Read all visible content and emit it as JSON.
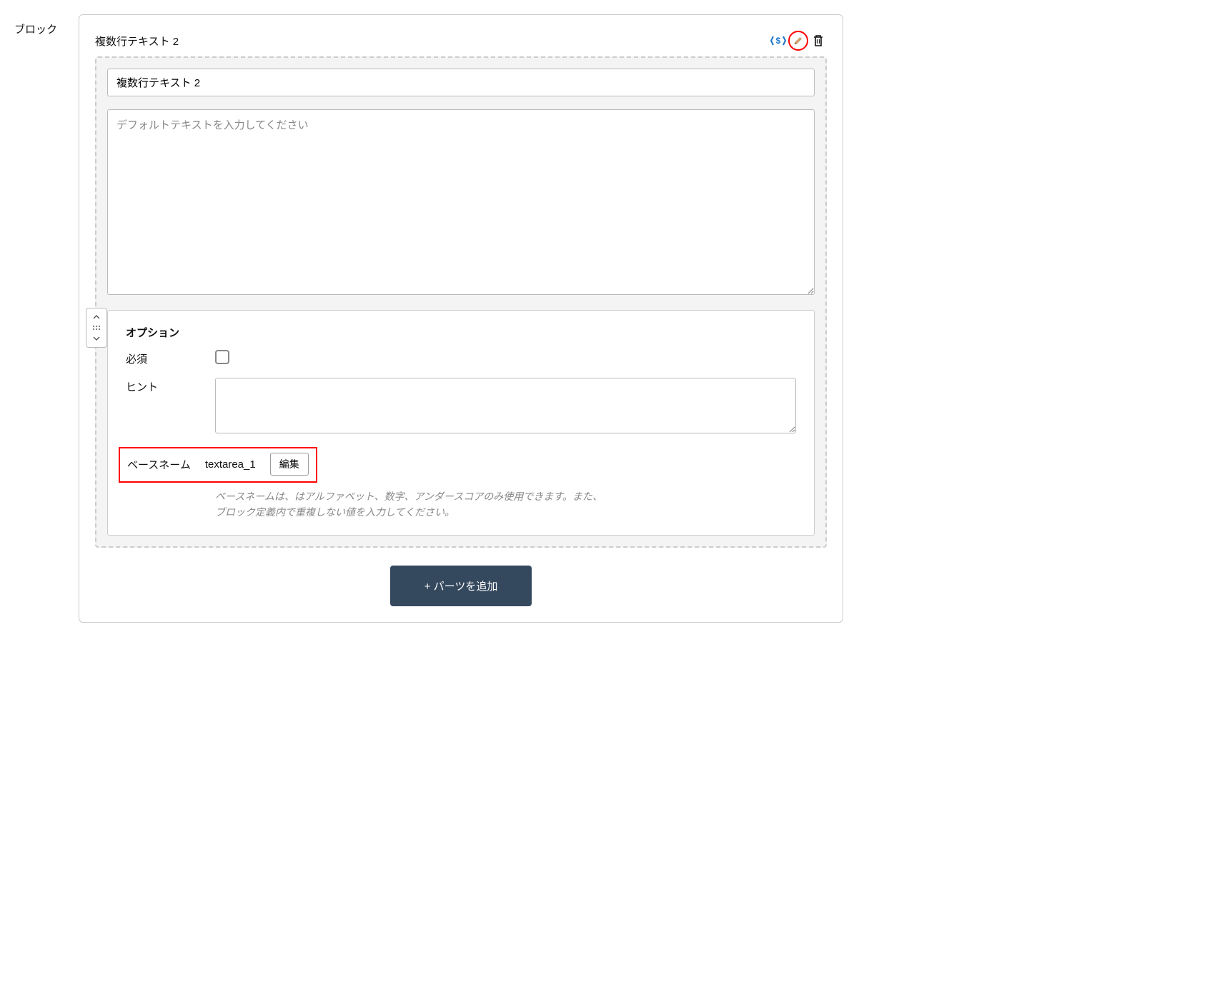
{
  "sidebar_label": "ブロック",
  "header": {
    "title": "複数行テキスト 2"
  },
  "fields": {
    "name_value": "複数行テキスト 2",
    "default_text_placeholder": "デフォルトテキストを入力してください"
  },
  "options": {
    "heading": "オプション",
    "required_label": "必須",
    "hint_label": "ヒント",
    "basename_label": "ベースネーム",
    "basename_value": "textarea_1",
    "basename_edit_button": "編集",
    "basename_help": "ベースネームは、はアルファベット、数字、アンダースコアのみ使用できます。また、ブロック定義内で重複しない値を入力してください。"
  },
  "footer": {
    "add_parts_label": "+ パーツを追加"
  }
}
